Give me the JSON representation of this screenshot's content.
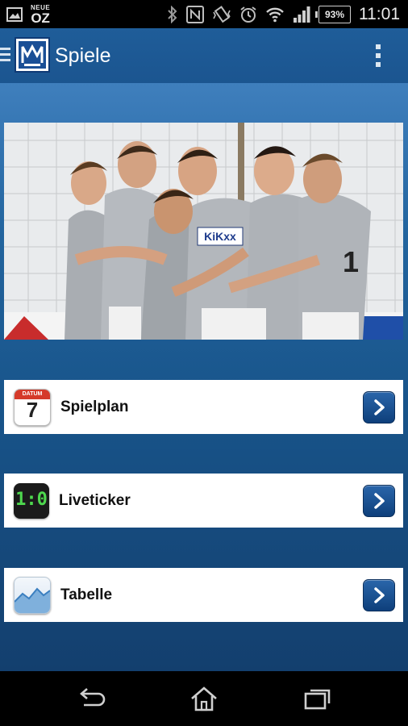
{
  "statusbar": {
    "notif_brand_small": "NEUE",
    "notif_brand_big": "OZ",
    "battery": "93%",
    "time": "11:01"
  },
  "appbar": {
    "title": "Spiele",
    "accent": "#1d5995"
  },
  "menu": [
    {
      "label": "Spielplan",
      "icon": "calendar-icon",
      "calendar_header": "DATUM",
      "calendar_day": "7"
    },
    {
      "label": "Liveticker",
      "icon": "scoreboard-icon",
      "score": "1:0"
    },
    {
      "label": "Tabelle",
      "icon": "chart-icon"
    }
  ],
  "photo": {
    "jersey_text": "KiKxx"
  },
  "navbar": {
    "buttons": [
      "back-icon",
      "home-icon",
      "recent-apps-icon"
    ]
  }
}
